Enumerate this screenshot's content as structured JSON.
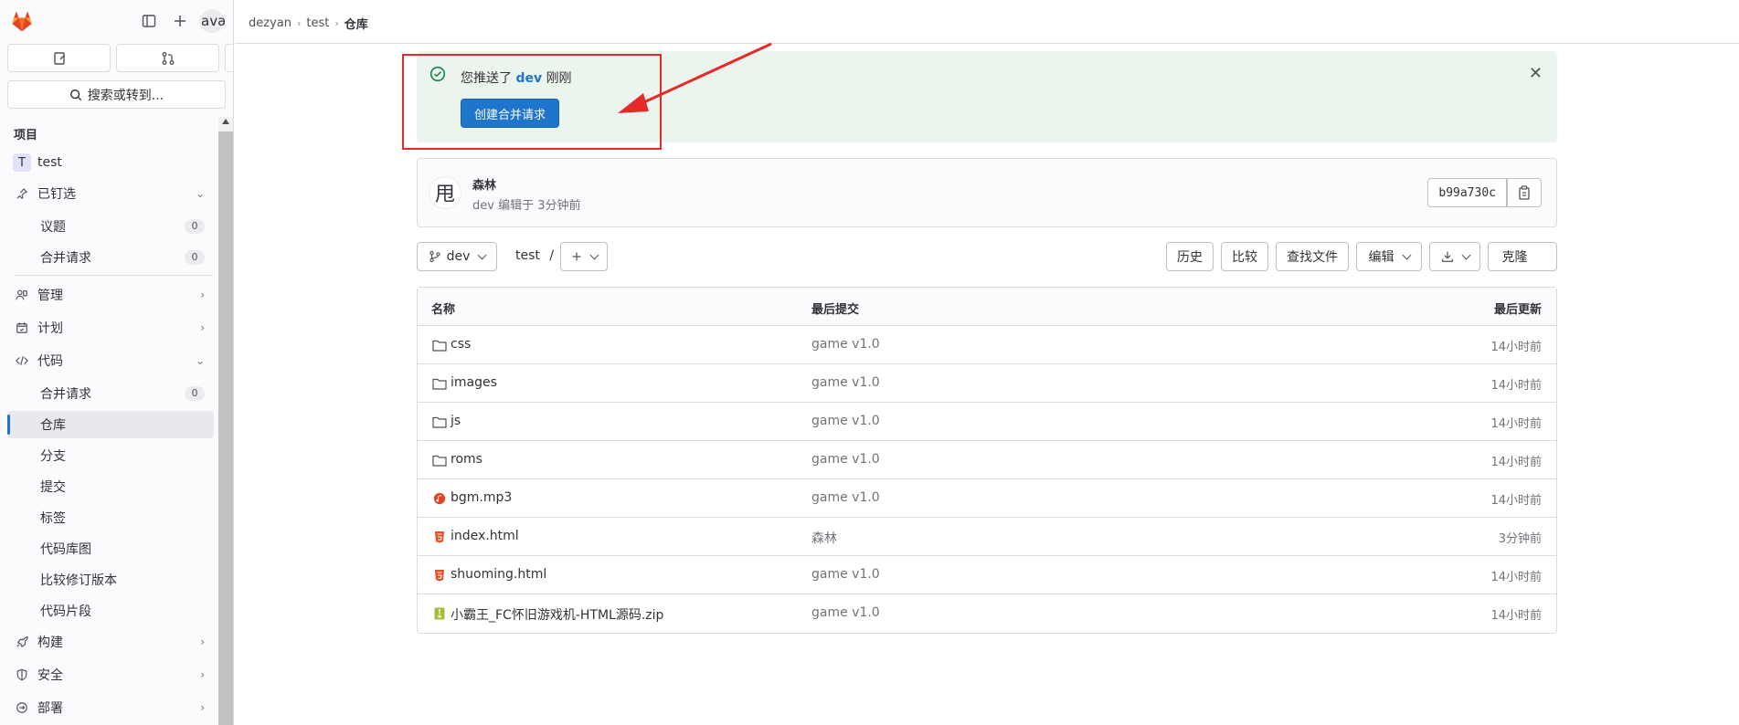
{
  "sidebar": {
    "avatar_text": "ava",
    "search_label": "搜索或转到...",
    "section_title": "项目",
    "project": {
      "initial": "T",
      "name": "test"
    },
    "pinned": {
      "label": "已钉选",
      "items": [
        {
          "label": "议题",
          "count": "0"
        },
        {
          "label": "合并请求",
          "count": "0"
        }
      ]
    },
    "nav": {
      "manage": "管理",
      "plan": "计划",
      "code": "代码",
      "code_items": [
        {
          "label": "合并请求",
          "count": "0"
        },
        {
          "label": "仓库"
        },
        {
          "label": "分支"
        },
        {
          "label": "提交"
        },
        {
          "label": "标签"
        },
        {
          "label": "代码库图"
        },
        {
          "label": "比较修订版本"
        },
        {
          "label": "代码片段"
        }
      ],
      "build": "构建",
      "secure": "安全",
      "deploy": "部署"
    }
  },
  "breadcrumb": [
    "dezyan",
    "test",
    "仓库"
  ],
  "alert": {
    "prefix": "您推送了",
    "branch": "dev",
    "suffix": "刚刚",
    "button": "创建合并请求"
  },
  "commit": {
    "avatar_char": "甩",
    "author": "森林",
    "meta": "dev 编辑于 3分钟前",
    "sha": "b99a730c"
  },
  "toolbar": {
    "branch": "dev",
    "path": "test",
    "path_sep": "/",
    "history": "历史",
    "compare": "比较",
    "find_file": "查找文件",
    "edit": "编辑",
    "clone": "克隆"
  },
  "table": {
    "headers": {
      "name": "名称",
      "last_commit": "最后提交",
      "last_update": "最后更新"
    },
    "rows": [
      {
        "name": "css",
        "type": "folder",
        "commit": "game v1.0",
        "time": "14小时前"
      },
      {
        "name": "images",
        "type": "folder",
        "commit": "game v1.0",
        "time": "14小时前"
      },
      {
        "name": "js",
        "type": "folder",
        "commit": "game v1.0",
        "time": "14小时前"
      },
      {
        "name": "roms",
        "type": "folder",
        "commit": "game v1.0",
        "time": "14小时前"
      },
      {
        "name": "bgm.mp3",
        "type": "audio",
        "commit": "game v1.0",
        "time": "14小时前"
      },
      {
        "name": "index.html",
        "type": "html",
        "commit": "森林",
        "time": "3分钟前"
      },
      {
        "name": "shuoming.html",
        "type": "html",
        "commit": "game v1.0",
        "time": "14小时前"
      },
      {
        "name": "小霸王_FC怀旧游戏机-HTML源码.zip",
        "type": "zip",
        "commit": "game v1.0",
        "time": "14小时前"
      }
    ]
  },
  "colors": {
    "accent": "#1f75cb",
    "alert_bg": "#ecf4ee",
    "annotation_red": "#e52a2a"
  }
}
